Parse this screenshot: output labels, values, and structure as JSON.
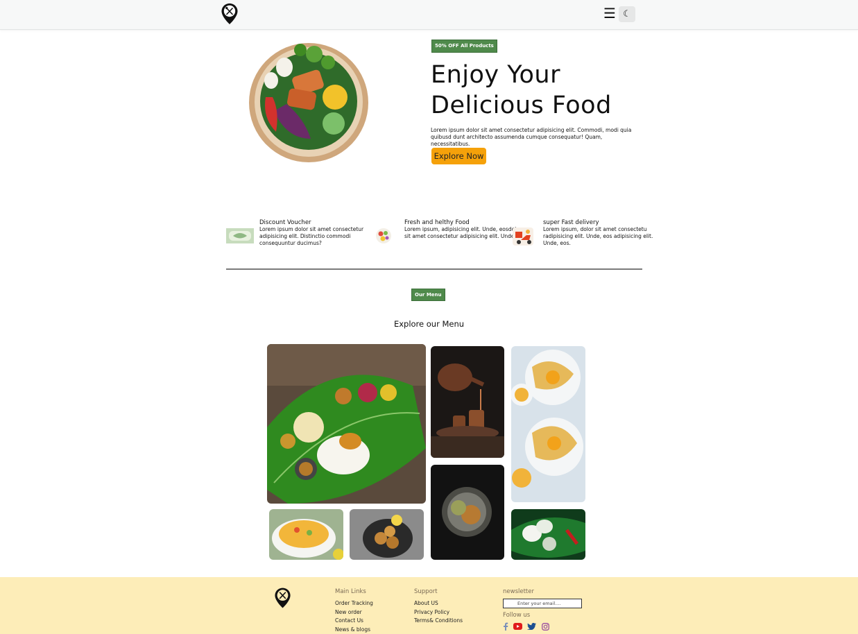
{
  "header": {
    "logo": "fork-spoon-pin-logo",
    "menu_icon": "☰",
    "theme_icon": "☾"
  },
  "hero": {
    "badge": "50% OFF All Products",
    "title_line1": "Enjoy Your",
    "title_line2": "Delicious Food",
    "description": "Lorem ipsum dolor sit amet consectetur adipisicing elit. Commodi, modi quia quibusd dunt architecto assumenda cumque consequatur! Quam, necessitatibus.",
    "cta": "Explore Now"
  },
  "features": [
    {
      "title": "Discount Voucher",
      "text": "Lorem ipsum dolor sit amet consectetur adipisicing elit. Distinctio commodi consequuntur ducimus?"
    },
    {
      "title": "Fresh and helthy Food",
      "text": "Lorem ipsum, adipisicing elit. Unde, eosdolor sit amet consectetur adipisicing elit. Unde, eos."
    },
    {
      "title": "super Fast delivery",
      "text": "Lorem ipsum, dolor sit amet consectetu radipisicing elit. Unde, eos adipisicing elit. Unde, eos."
    }
  ],
  "menu": {
    "badge": "Our Menu",
    "title": "Explore our Menu"
  },
  "footer": {
    "main_links": {
      "title": "Main Links",
      "items": [
        "Order Tracking",
        "New order",
        "Contact Us",
        "News & blogs"
      ]
    },
    "support": {
      "title": "Support",
      "items": [
        "About US",
        "Privacy Policy",
        "Terms& Conditions"
      ]
    },
    "newsletter": {
      "title": "newsletter",
      "placeholder": "Enter your email....",
      "follow": "Follow us"
    }
  },
  "colors": {
    "accent_green": "#4f8a4b",
    "cta_orange": "#f5a10a",
    "footer_bg": "#fdedb8"
  }
}
